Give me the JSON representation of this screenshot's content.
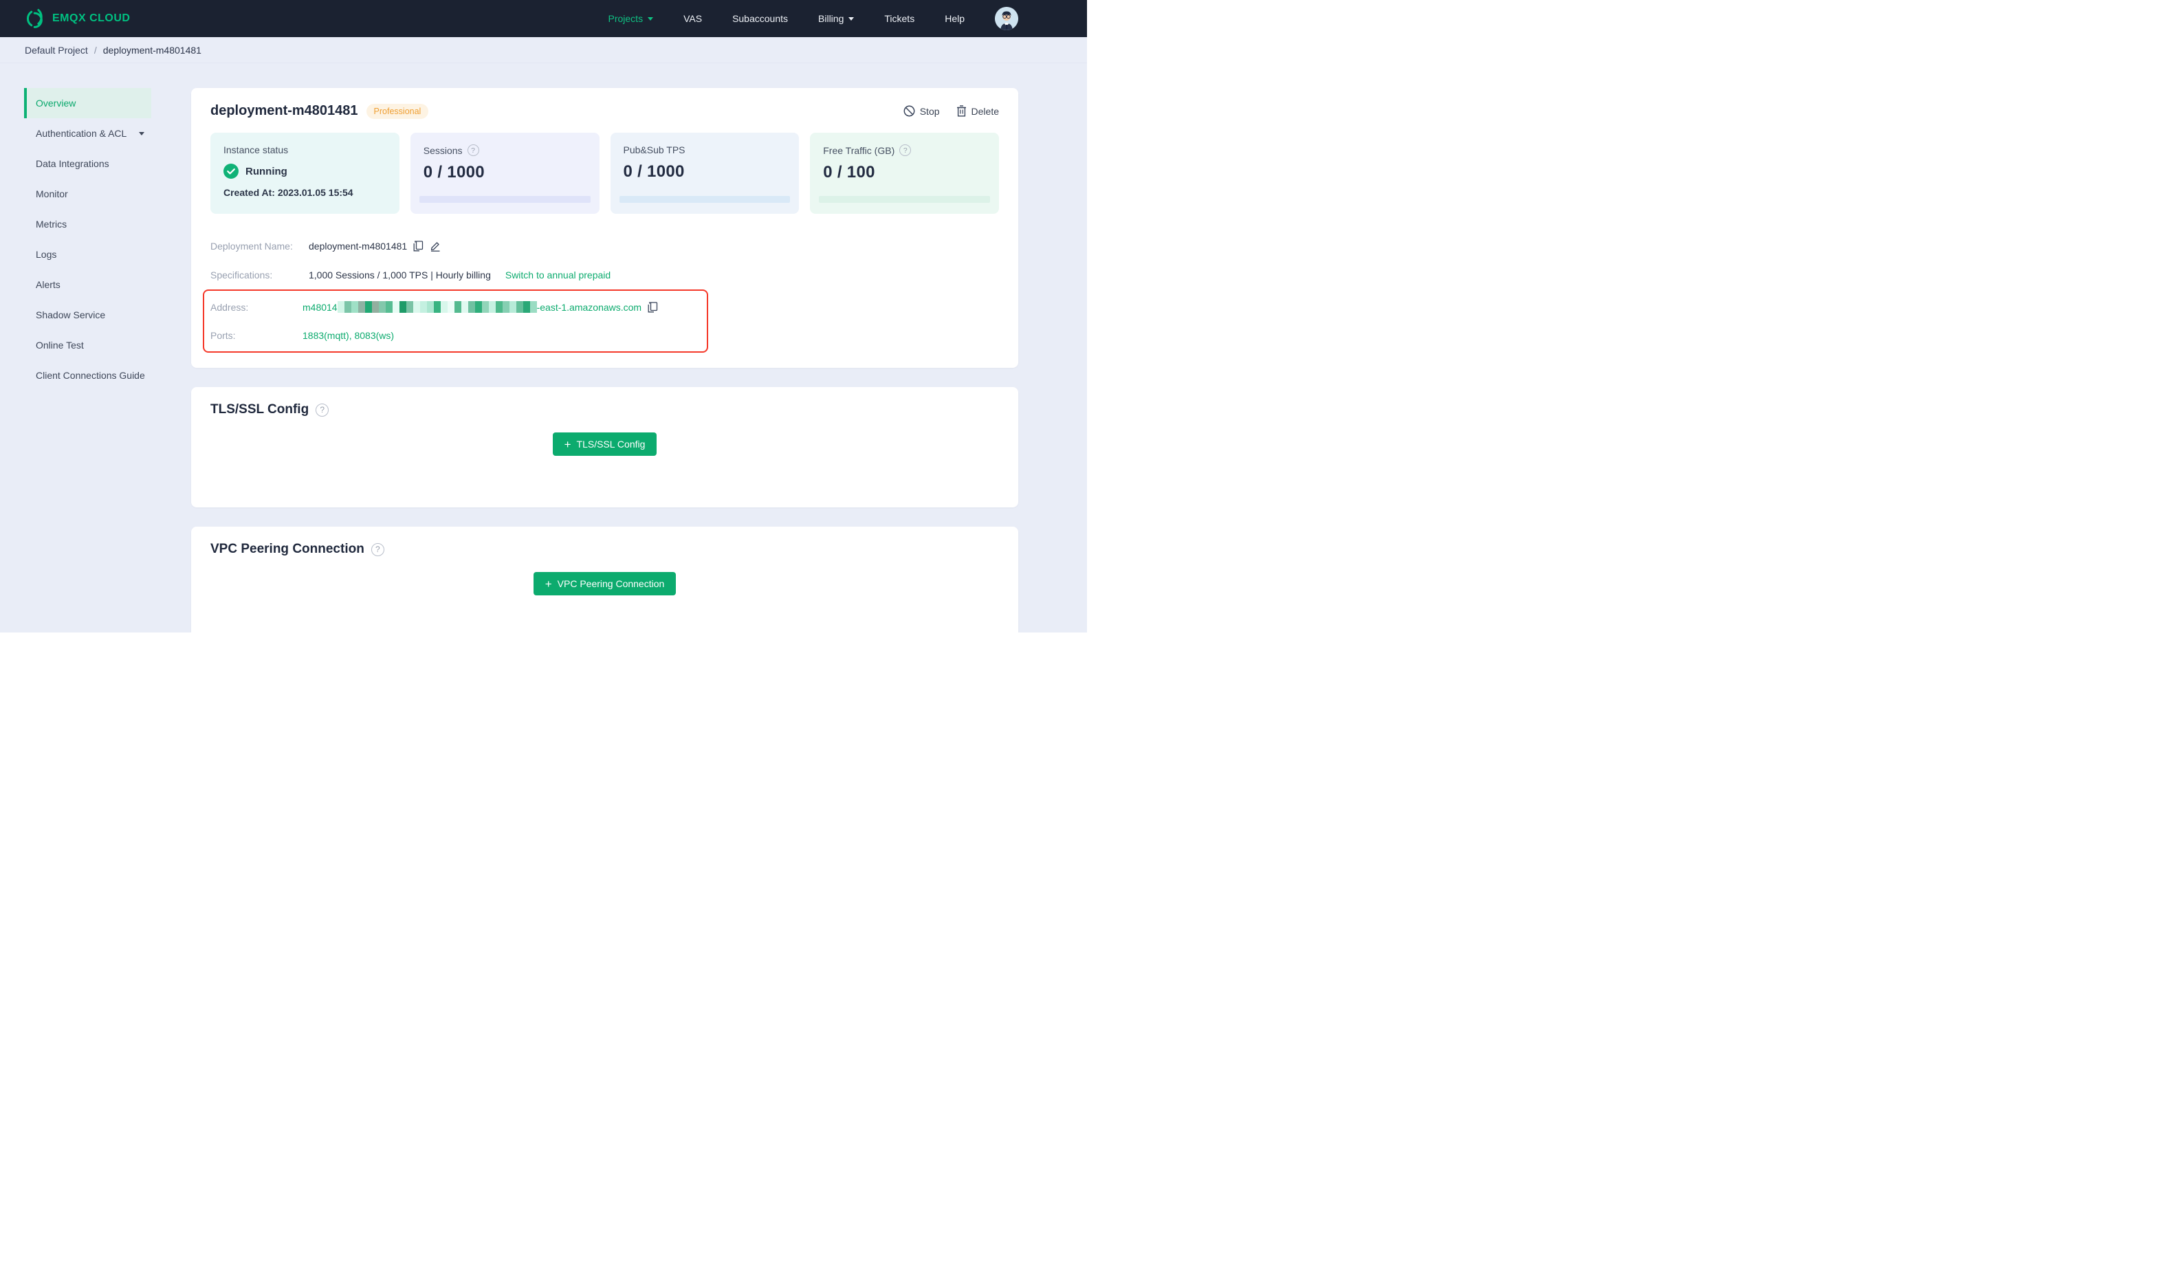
{
  "nav": {
    "brand": "EMQX CLOUD",
    "items": [
      {
        "label": "Projects"
      },
      {
        "label": "VAS"
      },
      {
        "label": "Subaccounts"
      },
      {
        "label": "Billing"
      },
      {
        "label": "Tickets"
      },
      {
        "label": "Help"
      }
    ]
  },
  "breadcrumb": {
    "project": "Default Project",
    "separator": "/",
    "page": "deployment-m4801481"
  },
  "sidebar": {
    "items": [
      {
        "label": "Overview"
      },
      {
        "label": "Authentication & ACL"
      },
      {
        "label": "Data Integrations"
      },
      {
        "label": "Monitor"
      },
      {
        "label": "Metrics"
      },
      {
        "label": "Logs"
      },
      {
        "label": "Alerts"
      },
      {
        "label": "Shadow Service"
      },
      {
        "label": "Online Test"
      },
      {
        "label": "Client Connections Guide"
      }
    ]
  },
  "overview": {
    "title": "deployment-m4801481",
    "badge": "Professional",
    "actions": {
      "stop": "Stop",
      "delete": "Delete"
    },
    "stats": {
      "instance": {
        "label": "Instance status",
        "status": "Running",
        "created": "Created At: 2023.01.05 15:54"
      },
      "sessions": {
        "label": "Sessions",
        "value": "0 / 1000"
      },
      "tps": {
        "label": "Pub&Sub TPS",
        "value": "0 / 1000"
      },
      "traffic": {
        "label": "Free Traffic (GB)",
        "value": "0 / 100"
      }
    },
    "details": {
      "deployment_name_label": "Deployment Name:",
      "deployment_name": "deployment-m4801481",
      "specifications_label": "Specifications:",
      "specifications": "1,000 Sessions / 1,000 TPS | Hourly billing",
      "switch_link": "Switch to annual prepaid",
      "address_label": "Address:",
      "address_prefix": "m48014",
      "address_suffix": "-east-1.amazonaws.com",
      "ports_label": "Ports:",
      "ports": "1883(mqtt), 8083(ws)",
      "redaction_colors": [
        "#d2f5e7",
        "#7cc5a8",
        "#9fe0c6",
        "#8fb2a3",
        "#22a974",
        "#93af9f",
        "#83c8ab",
        "#57bd92",
        "#e7fcf4",
        "#1f9b68",
        "#7ac3a5",
        "#dbf8ed",
        "#c4f0e0",
        "#abe6d0",
        "#38b381",
        "#d8f7eb",
        "#ecfdf7",
        "#54ba8f",
        "#e0f9f0",
        "#70c1a1",
        "#2fae7b",
        "#92d5b9",
        "#c5f1e1",
        "#4db98b",
        "#86cfb2",
        "#b7ebd8",
        "#63bf9a",
        "#2aa877",
        "#9bdcc3"
      ]
    }
  },
  "tls": {
    "title": "TLS/SSL Config",
    "button": "TLS/SSL Config"
  },
  "vpc": {
    "title": "VPC Peering Connection",
    "button": "VPC Peering Connection"
  },
  "colors": {
    "nav_bg": "#1b2231",
    "brand_green": "#00c181",
    "accent_green": "#0cab6e",
    "page_bg": "#e9edf7",
    "badge_orange": "#ef9f33",
    "badge_bg": "#fdf3e3",
    "highlight_red": "#f5392a",
    "running_green": "#10b277",
    "stat_instance_bg": "#e9f7f7",
    "stat_sessions_bg": "#eff1fc",
    "stat_tps_bg": "#edf3fa",
    "stat_traffic_bg": "#ebf8f2",
    "bar_sessions": "#dfe3f9",
    "bar_tps": "#d9e9f7",
    "bar_traffic": "#dcf2e8"
  }
}
